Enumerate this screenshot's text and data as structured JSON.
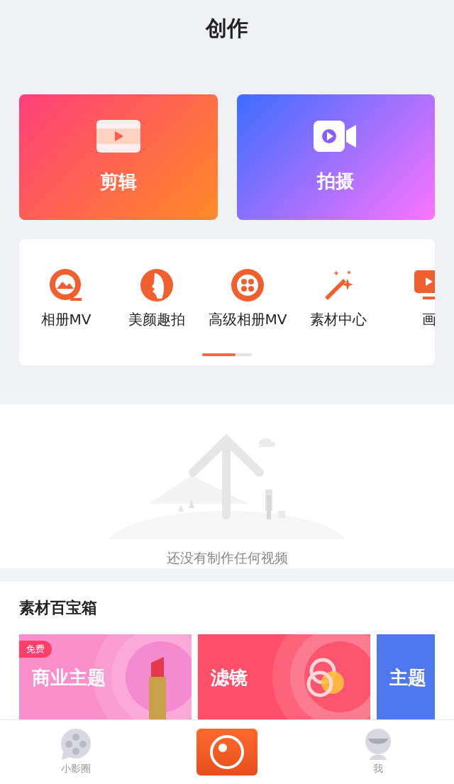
{
  "header": {
    "title": "创作"
  },
  "main_actions": [
    {
      "label": "剪辑",
      "kind": "edit"
    },
    {
      "label": "拍摄",
      "kind": "shoot"
    }
  ],
  "tools": [
    {
      "label": "相册MV",
      "kind": "album"
    },
    {
      "label": "美颜趣拍",
      "kind": "beauty"
    },
    {
      "label": "高级相册MV",
      "kind": "reel"
    },
    {
      "label": "素材中心",
      "kind": "wand"
    },
    {
      "label": "画",
      "kind": "screen"
    }
  ],
  "empty_state": {
    "message": "还没有制作任何视频"
  },
  "materials": {
    "title": "素材百宝箱",
    "cards": [
      {
        "label": "商业主题",
        "badge": "免费",
        "kind": "lipstick"
      },
      {
        "label": "滤镜",
        "kind": "filter"
      },
      {
        "label": "主题",
        "kind": "plain"
      }
    ]
  },
  "tab_bar": {
    "items": [
      {
        "label": "小影圈",
        "kind": "feed",
        "selected": false
      },
      {
        "kind": "camera",
        "selected": true
      },
      {
        "label": "我",
        "kind": "me",
        "selected": false
      }
    ]
  }
}
